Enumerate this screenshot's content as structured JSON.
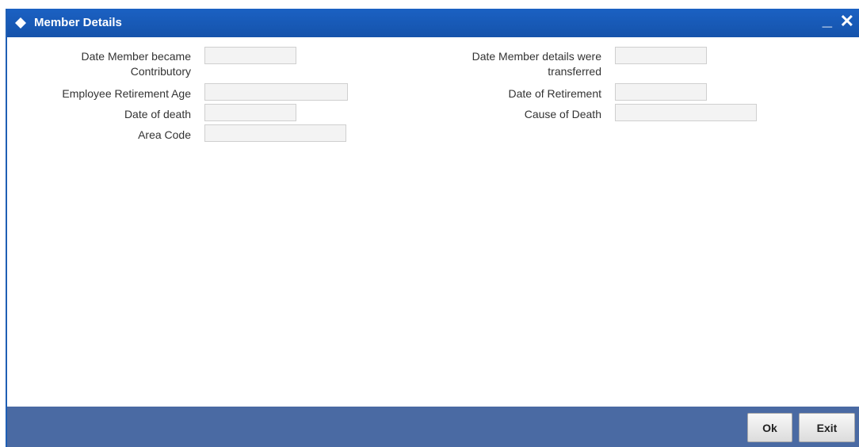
{
  "window": {
    "title": "Member Details",
    "minimize_label": "_",
    "close_label": "✕"
  },
  "form": {
    "date_became_contributory": {
      "label_line1": "Date Member became",
      "label_line2": "Contributory",
      "value": ""
    },
    "date_details_transferred": {
      "label_line1": "Date Member details were",
      "label_line2": "transferred",
      "value": ""
    },
    "employee_retirement_age": {
      "label": "Employee Retirement Age",
      "value": ""
    },
    "date_of_retirement": {
      "label": "Date of Retirement",
      "value": ""
    },
    "date_of_death": {
      "label": "Date of death",
      "value": ""
    },
    "cause_of_death": {
      "label": "Cause of Death",
      "value": ""
    },
    "area_code": {
      "label": "Area Code",
      "value": ""
    }
  },
  "footer": {
    "ok_label": "Ok",
    "exit_label": "Exit"
  },
  "icons": {
    "title_icon": "diamond-icon"
  },
  "colors": {
    "titlebar": "#1b61c3",
    "footer": "#4a6aa3",
    "field_bg": "#f3f3f3"
  }
}
